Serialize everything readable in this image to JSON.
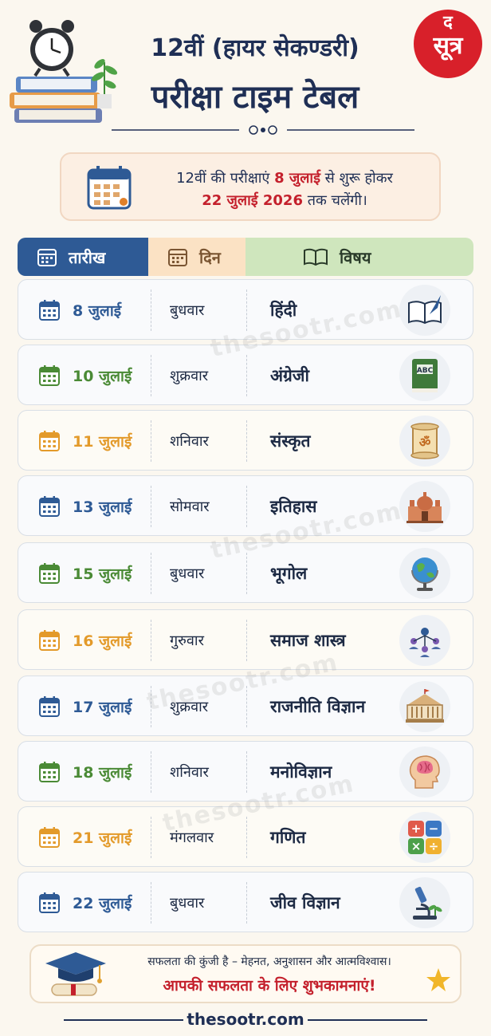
{
  "header": {
    "title_line1": "12वीं (हायर सेकण्डरी)",
    "title_line2": "परीक्षा टाइम टेबल",
    "logo_top": "द",
    "logo_bottom": "सूत्र"
  },
  "info": {
    "line1_pre": "12वीं की परीक्षाएं ",
    "line1_highlight": "8 जुलाई",
    "line1_post": " से शुरू होकर",
    "line2_highlight": "22 जुलाई 2026",
    "line2_post": " तक चलेंगी।"
  },
  "table": {
    "headers": {
      "date": "तारीख",
      "day": "दिन",
      "subject": "विषय"
    },
    "rows": [
      {
        "date": "8 जुलाई",
        "day": "बुधवार",
        "subject": "हिंदी",
        "icon": "book-quill-icon",
        "color": "#2e5a95"
      },
      {
        "date": "10 जुलाई",
        "day": "शुक्रवार",
        "subject": "अंग्रेजी",
        "icon": "abc-book-icon",
        "color": "#4a8a35"
      },
      {
        "date": "11 जुलाई",
        "day": "शनिवार",
        "subject": "संस्कृत",
        "icon": "om-scroll-icon",
        "color": "#e39a2a"
      },
      {
        "date": "13 जुलाई",
        "day": "सोमवार",
        "subject": "इतिहास",
        "icon": "monument-icon",
        "color": "#2e5a95"
      },
      {
        "date": "15 जुलाई",
        "day": "बुधवार",
        "subject": "भूगोल",
        "icon": "globe-icon",
        "color": "#4a8a35"
      },
      {
        "date": "16 जुलाई",
        "day": "गुरुवार",
        "subject": "समाज शास्त्र",
        "icon": "people-network-icon",
        "color": "#e39a2a"
      },
      {
        "date": "17 जुलाई",
        "day": "शुक्रवार",
        "subject": "राजनीति विज्ञान",
        "icon": "parliament-icon",
        "color": "#2e5a95"
      },
      {
        "date": "18 जुलाई",
        "day": "शनिवार",
        "subject": "मनोविज्ञान",
        "icon": "brain-head-icon",
        "color": "#4a8a35"
      },
      {
        "date": "21 जुलाई",
        "day": "मंगलवार",
        "subject": "गणित",
        "icon": "calculator-icon",
        "color": "#e39a2a"
      },
      {
        "date": "22 जुलाई",
        "day": "बुधवार",
        "subject": "जीव विज्ञान",
        "icon": "microscope-icon",
        "color": "#2e5a95"
      }
    ]
  },
  "watermark": "thesootr.com",
  "footer": {
    "line1": "सफलता की कुंजी है – मेहनत, अनुशासन और आत्मविश्वास।",
    "line2": "आपकी सफलता के लिए शुभकामनाएं!",
    "site": "thesootr.com"
  }
}
